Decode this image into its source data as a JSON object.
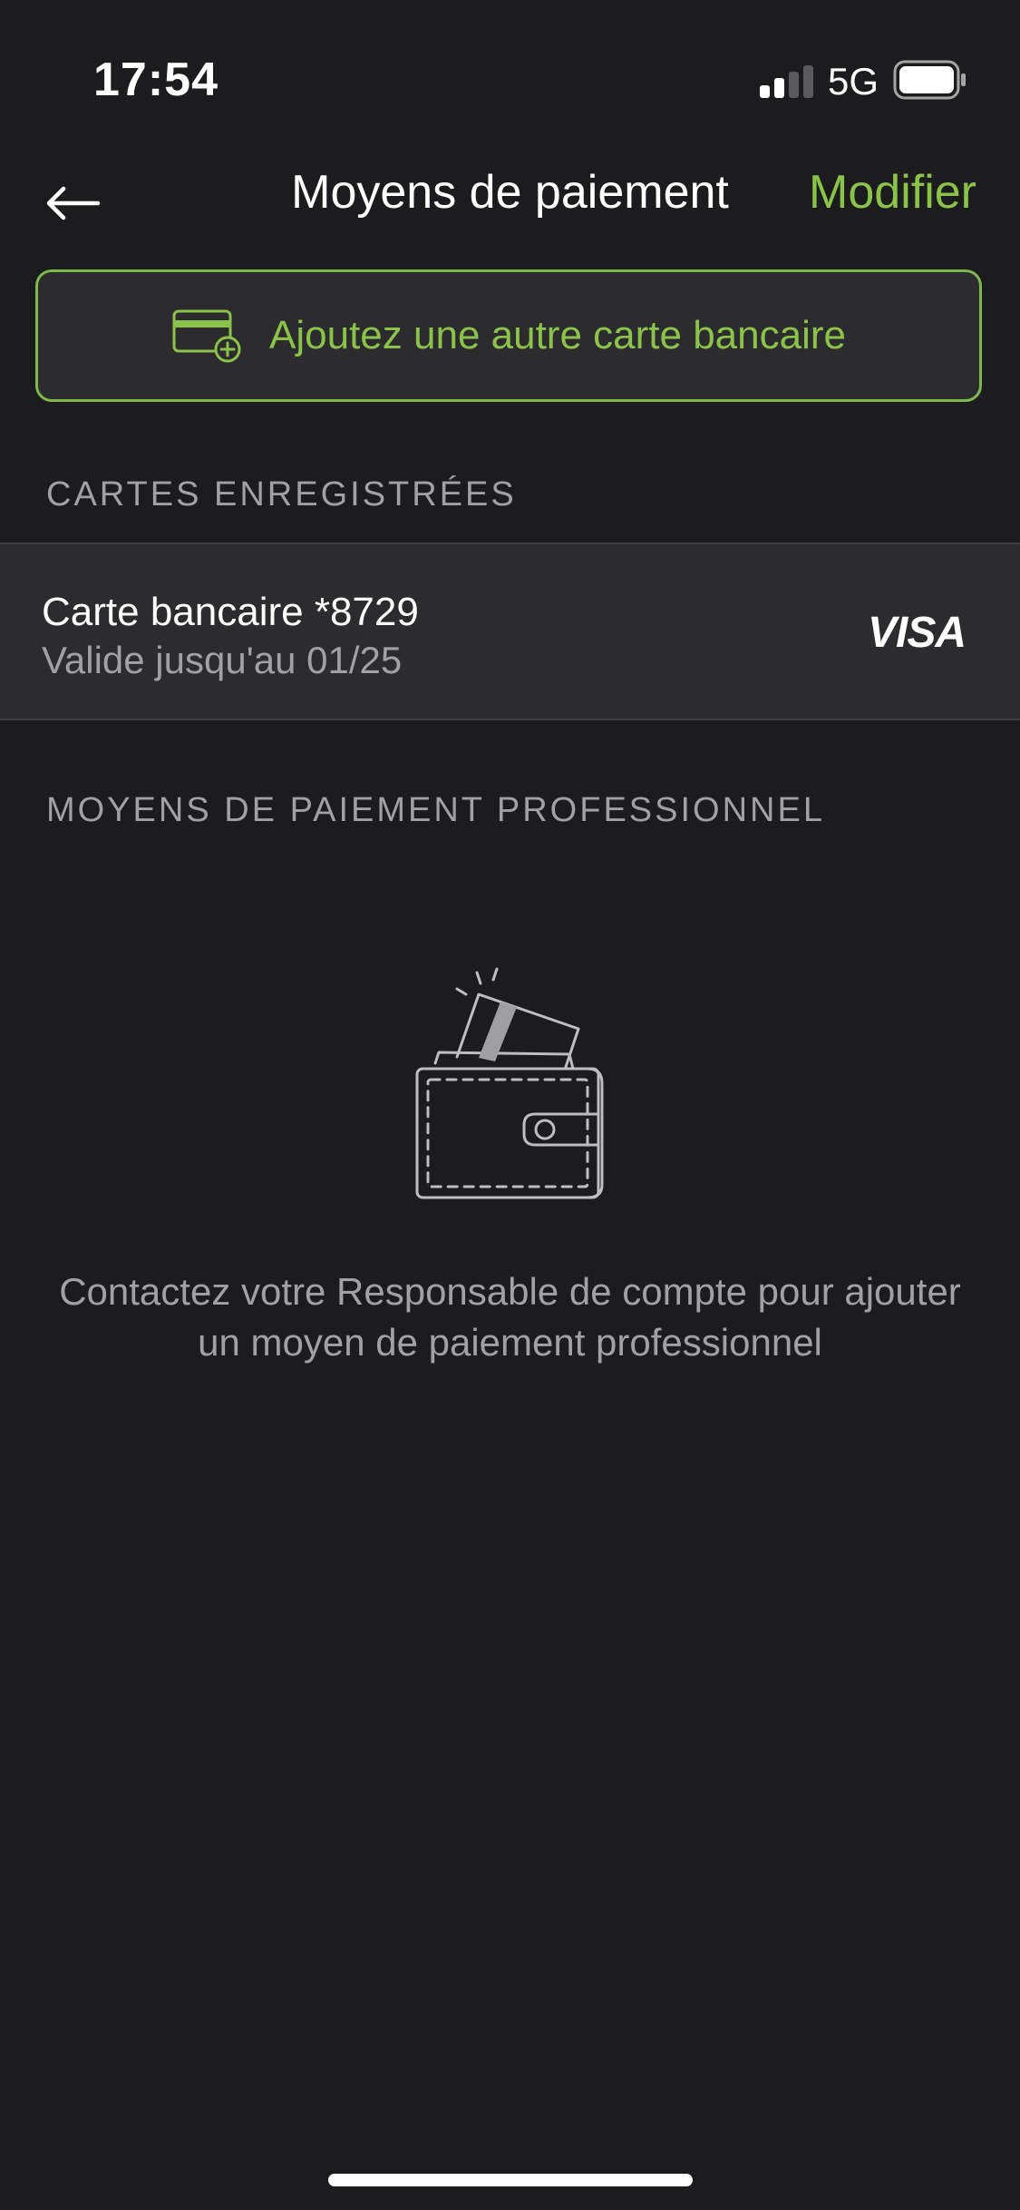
{
  "status_bar": {
    "time": "17:54",
    "network": "5G",
    "icons": [
      "signal-icon",
      "battery-icon"
    ]
  },
  "nav": {
    "title": "Moyens de paiement",
    "edit_label": "Modifier",
    "back_icon": "arrow-left-icon"
  },
  "add_card": {
    "label": "Ajoutez une autre carte bancaire",
    "icon": "credit-card-add-icon"
  },
  "saved_cards": {
    "header": "CARTES ENREGISTRÉES",
    "items": [
      {
        "name": "Carte bancaire *8729",
        "expiry": "Valide jusqu'au 01/25",
        "brand": "VISA"
      }
    ]
  },
  "professional": {
    "header": "MOYENS DE PAIEMENT PROFESSIONNEL",
    "illustration": "wallet-icon",
    "empty_message": "Contactez votre Responsable de compte pour ajouter un moyen de paiement professionnel"
  },
  "colors": {
    "background": "#1c1c1e",
    "surface": "#2c2c2e",
    "accent": "#8bc34a",
    "secondary_text": "#a0a0a5"
  }
}
